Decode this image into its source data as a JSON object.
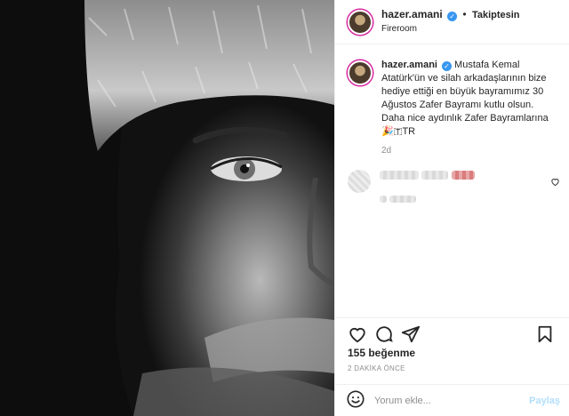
{
  "header": {
    "username": "hazer.amani",
    "separator": "•",
    "follow_state": "Takiptesin",
    "location": "Fireroom"
  },
  "caption": {
    "username": "hazer.amani",
    "text": "Mustafa Kemal Atatürk'ün ve silah arkadaşlarının bize hediye ettiği en büyük bayramımız 30 Ağustos Zafer Bayramı kutlu olsun. Daha nice aydınlık Zafer Bayramlarına",
    "emoji_tail": "TR",
    "age": "2d"
  },
  "actions": {
    "likes": "155 beğenme",
    "time_ago": "2 DAKİKA ÖNCE"
  },
  "comment_box": {
    "placeholder": "Yorum ekle...",
    "submit_label": "Paylaş"
  },
  "icons": {
    "verified": "verified-badge-icon",
    "like": "heart-outline-icon",
    "comment": "speech-bubble-icon",
    "share": "paper-plane-icon",
    "save": "bookmark-icon",
    "emoji": "smiley-icon"
  },
  "colors": {
    "verified_blue": "#3897f0",
    "muted_text": "#8e8e8e",
    "share_disabled": "#b2dffc"
  }
}
